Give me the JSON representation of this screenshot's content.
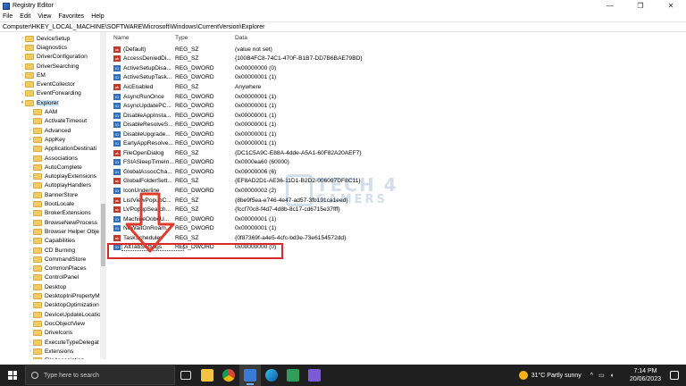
{
  "window": {
    "title": "Registry Editor",
    "minimize": "—",
    "maximize": "❐",
    "close": "✕"
  },
  "menu": [
    "File",
    "Edit",
    "View",
    "Favorites",
    "Help"
  ],
  "address": "Computer\\HKEY_LOCAL_MACHINE\\SOFTWARE\\Microsoft\\Windows\\CurrentVersion\\Explorer",
  "tree": [
    {
      "label": "DeviceSetup",
      "level": 1,
      "expand": true
    },
    {
      "label": "Diagnostics",
      "level": 1,
      "expand": true
    },
    {
      "label": "DriverConfiguration",
      "level": 1,
      "expand": true
    },
    {
      "label": "DriverSearching",
      "level": 1,
      "expand": true
    },
    {
      "label": "EM",
      "level": 1,
      "expand": true
    },
    {
      "label": "EventCollector",
      "level": 1,
      "expand": true
    },
    {
      "label": "EventForwarding",
      "level": 1,
      "expand": true
    },
    {
      "label": "Explorer",
      "level": 1,
      "expand": false,
      "open": true,
      "selected": true
    },
    {
      "label": "AAM",
      "level": 2,
      "expand": false
    },
    {
      "label": "ActivateTimeout",
      "level": 2,
      "expand": false
    },
    {
      "label": "Advanced",
      "level": 2,
      "expand": true
    },
    {
      "label": "AppKey",
      "level": 2,
      "expand": true
    },
    {
      "label": "ApplicationDestinati",
      "level": 2,
      "expand": false
    },
    {
      "label": "Associations",
      "level": 2,
      "expand": false
    },
    {
      "label": "AutoComplete",
      "level": 2,
      "expand": true
    },
    {
      "label": "AutoplayExtensions",
      "level": 2,
      "expand": true
    },
    {
      "label": "AutoplayHandlers",
      "level": 2,
      "expand": true
    },
    {
      "label": "BannerStore",
      "level": 2,
      "expand": false
    },
    {
      "label": "BootLocale",
      "level": 2,
      "expand": false
    },
    {
      "label": "BrokerExtensions",
      "level": 2,
      "expand": true
    },
    {
      "label": "BrowseNewProcess",
      "level": 2,
      "expand": false
    },
    {
      "label": "Browser Helper Obje",
      "level": 2,
      "expand": true
    },
    {
      "label": "Capabilities",
      "level": 2,
      "expand": true
    },
    {
      "label": "CD Burning",
      "level": 2,
      "expand": true
    },
    {
      "label": "CommandStore",
      "level": 2,
      "expand": true
    },
    {
      "label": "CommonPlaces",
      "level": 2,
      "expand": true
    },
    {
      "label": "ControlPanel",
      "level": 2,
      "expand": true
    },
    {
      "label": "Desktop",
      "level": 2,
      "expand": true
    },
    {
      "label": "DesktopIniPropertyM",
      "level": 2,
      "expand": true
    },
    {
      "label": "DesktopOptimization",
      "level": 2,
      "expand": false
    },
    {
      "label": "DeviceUpdateLocatio",
      "level": 2,
      "expand": true
    },
    {
      "label": "DocObjectView",
      "level": 2,
      "expand": false
    },
    {
      "label": "DriveIcons",
      "level": 2,
      "expand": false
    },
    {
      "label": "ExecuteTypeDelegat",
      "level": 2,
      "expand": true
    },
    {
      "label": "Extensions",
      "level": 2,
      "expand": true
    },
    {
      "label": "FileAssociation",
      "level": 2,
      "expand": true
    }
  ],
  "columns": {
    "name": "Name",
    "type": "Type",
    "data": "Data"
  },
  "values": [
    {
      "name": "(Default)",
      "type": "REG_SZ",
      "data": "(value not set)",
      "kind": "sz"
    },
    {
      "name": "AccessDeniedDi...",
      "type": "REG_SZ",
      "data": "{100B4FC8-74C1-470F-B1B7-DD7B6BAE79BD}",
      "kind": "sz"
    },
    {
      "name": "ActiveSetupDisa...",
      "type": "REG_DWORD",
      "data": "0x00000000 (0)",
      "kind": "dw"
    },
    {
      "name": "ActiveSetupTask...",
      "type": "REG_DWORD",
      "data": "0x00000001 (1)",
      "kind": "dw"
    },
    {
      "name": "AicEnabled",
      "type": "REG_SZ",
      "data": "Anywhere",
      "kind": "sz"
    },
    {
      "name": "AsyncRunOnce",
      "type": "REG_DWORD",
      "data": "0x00000001 (1)",
      "kind": "dw"
    },
    {
      "name": "AsyncUpdatePC...",
      "type": "REG_DWORD",
      "data": "0x00000001 (1)",
      "kind": "dw"
    },
    {
      "name": "DisableAppInsta...",
      "type": "REG_DWORD",
      "data": "0x00000001 (1)",
      "kind": "dw"
    },
    {
      "name": "DisableResolveS...",
      "type": "REG_DWORD",
      "data": "0x00000001 (1)",
      "kind": "dw"
    },
    {
      "name": "DisableUpgrade...",
      "type": "REG_DWORD",
      "data": "0x00000001 (1)",
      "kind": "dw"
    },
    {
      "name": "EarlyAppResolve...",
      "type": "REG_DWORD",
      "data": "0x00000001 (1)",
      "kind": "dw"
    },
    {
      "name": "FileOpenDialog",
      "type": "REG_SZ",
      "data": "{DC1C5A9C-E88A-4dde-A5A1-60F82A20AEF7}",
      "kind": "sz"
    },
    {
      "name": "FSIASleepTimeIn...",
      "type": "REG_DWORD",
      "data": "0x0000ea60 (60000)",
      "kind": "dw"
    },
    {
      "name": "GlobalAssocCha...",
      "type": "REG_DWORD",
      "data": "0x00000006 (6)",
      "kind": "dw"
    },
    {
      "name": "GlobalFolderSett...",
      "type": "REG_SZ",
      "data": "{EF8AD2D1-AE36-11D1-B2D2-006097DF8C11}",
      "kind": "sz"
    },
    {
      "name": "IconUnderline",
      "type": "REG_DWORD",
      "data": "0x00000002 (2)",
      "kind": "dw"
    },
    {
      "name": "ListViewPopupC...",
      "type": "REG_SZ",
      "data": "{8be9f5ea-e746-4e47-ad57-3fb191ca1eed}",
      "kind": "sz"
    },
    {
      "name": "LVPopupSearch...",
      "type": "REG_SZ",
      "data": "{fccf70c8-f4d7-4d8b-8c17-cd6715e37fff}",
      "kind": "sz"
    },
    {
      "name": "MachineOobeU...",
      "type": "REG_DWORD",
      "data": "0x00000001 (1)",
      "kind": "dw"
    },
    {
      "name": "NoWaitOnRoam...",
      "type": "REG_DWORD",
      "data": "0x00000001 (1)",
      "kind": "dw"
    },
    {
      "name": "TaskScheduler",
      "type": "REG_SZ",
      "data": "{0f87369f-a4e5-4cfc-bd3e-73e6154572dd}",
      "kind": "sz"
    },
    {
      "name": "AltTabSettings",
      "type": "REG_DWORD",
      "data": "0x00000000 (0)",
      "kind": "dw",
      "selected": true
    }
  ],
  "watermark": {
    "line1": "TECH 4",
    "line2": "GAMERS"
  },
  "taskbar": {
    "search_placeholder": "Type here to search",
    "weather": "31°C  Partly sunny",
    "time": "7:14 PM",
    "date": "20/06/2023"
  },
  "colors": {
    "highlight_box": "#d42a2a",
    "arrow": "#e03c2b",
    "selection": "#cde8ff"
  }
}
